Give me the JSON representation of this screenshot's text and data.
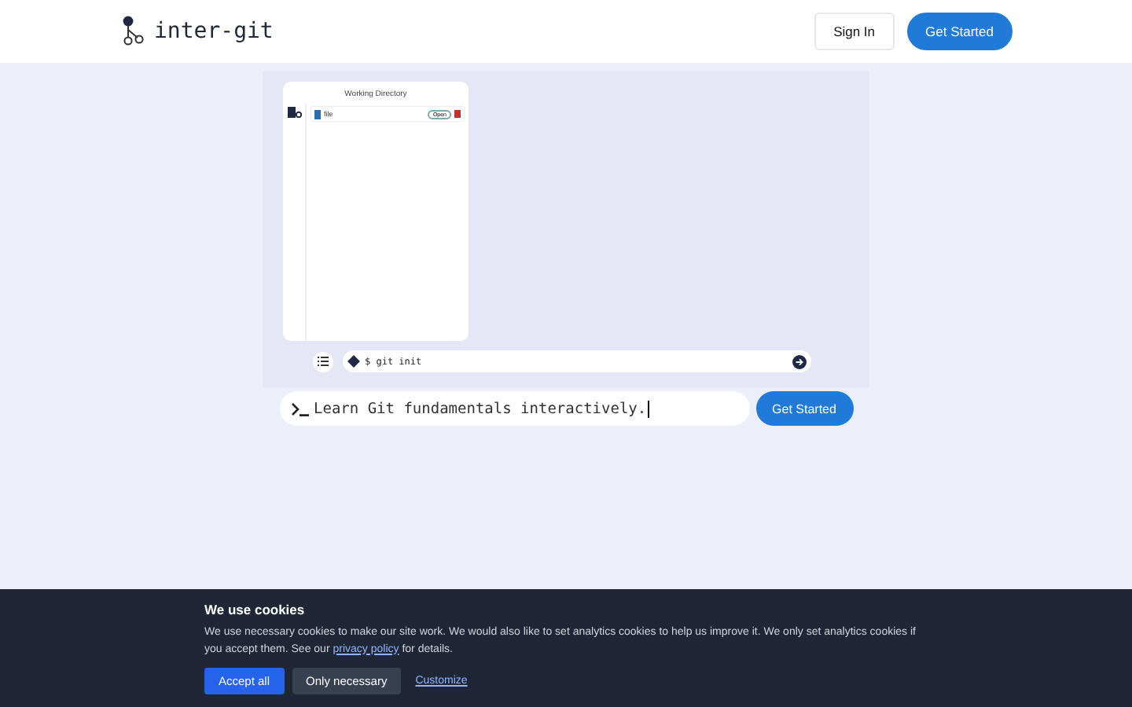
{
  "header": {
    "logo": "inter-git",
    "sign_in": "Sign In",
    "get_started": "Get Started"
  },
  "demo": {
    "panel_title": "Working Directory",
    "files": [
      {
        "name": "file",
        "action": "Open"
      }
    ],
    "command": "$ git init"
  },
  "hero": {
    "text": "Learn Git fundamentals interactively.",
    "button": "Get Started"
  },
  "cookies": {
    "title": "We use cookies",
    "text": "We use necessary cookies to make our site work. We would also like to set analytics cookies to help us improve it. We only set analytics cookies if you accept them. See our",
    "link": "privacy policy",
    "text_end": "for details.",
    "accept": "Accept all",
    "necessary": "Only necessary",
    "customize": "Customize"
  }
}
